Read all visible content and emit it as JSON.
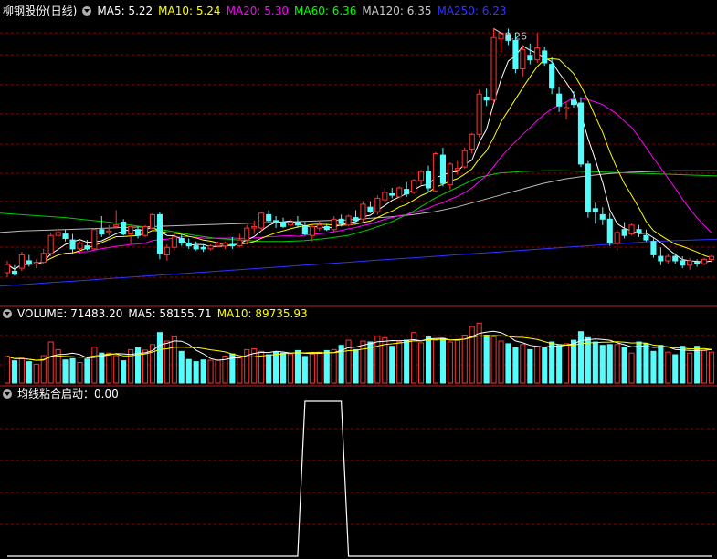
{
  "price_panel": {
    "title": "柳钢股份(日线)",
    "ma_legend": [
      {
        "label": "MA5: 5.22",
        "color": "#ffffff"
      },
      {
        "label": "MA10: 5.24",
        "color": "#ffff00"
      },
      {
        "label": "MA20: 5.30",
        "color": "#ff00ff"
      },
      {
        "label": "MA60: 6.36",
        "color": "#00ff00"
      },
      {
        "label": "MA120: 6.35",
        "color": "#cccccc"
      },
      {
        "label": "MA250: 6.23",
        "color": "#3333ff"
      }
    ],
    "peak_label": "8.26"
  },
  "volume_panel": {
    "legend": [
      {
        "label": "VOLUME: 71483.20",
        "color": "#ffffff"
      },
      {
        "label": "MA5: 58155.71",
        "color": "#ffffff"
      },
      {
        "label": "MA10: 89735.93",
        "color": "#ffff00"
      }
    ]
  },
  "indicator_panel": {
    "legend": [
      {
        "label": "均线粘合启动：0.00",
        "color": "#ffffff"
      }
    ]
  },
  "colors": {
    "up": "#ff3333",
    "down": "#54fcfc",
    "grid": "#8b0000",
    "frame": "#b22222"
  },
  "chart_data": {
    "type": "candlestick",
    "candles": [
      {
        "o": 4.98,
        "h": 5.14,
        "l": 4.92,
        "c": 5.09
      },
      {
        "o": 5.0,
        "h": 5.08,
        "l": 4.94,
        "c": 4.96
      },
      {
        "o": 5.04,
        "h": 5.26,
        "l": 5.0,
        "c": 5.22
      },
      {
        "o": 5.14,
        "h": 5.22,
        "l": 5.06,
        "c": 5.1
      },
      {
        "o": 5.1,
        "h": 5.16,
        "l": 5.04,
        "c": 5.12
      },
      {
        "o": 5.12,
        "h": 5.3,
        "l": 5.1,
        "c": 5.24
      },
      {
        "o": 5.24,
        "h": 5.52,
        "l": 5.2,
        "c": 5.48
      },
      {
        "o": 5.48,
        "h": 5.6,
        "l": 5.42,
        "c": 5.52
      },
      {
        "o": 5.5,
        "h": 5.56,
        "l": 5.4,
        "c": 5.44
      },
      {
        "o": 5.42,
        "h": 5.5,
        "l": 5.24,
        "c": 5.3
      },
      {
        "o": 5.3,
        "h": 5.4,
        "l": 5.24,
        "c": 5.38
      },
      {
        "o": 5.34,
        "h": 5.42,
        "l": 5.28,
        "c": 5.3
      },
      {
        "o": 5.3,
        "h": 5.58,
        "l": 5.28,
        "c": 5.56
      },
      {
        "o": 5.56,
        "h": 5.74,
        "l": 5.46,
        "c": 5.5
      },
      {
        "o": 5.52,
        "h": 5.62,
        "l": 5.48,
        "c": 5.54
      },
      {
        "o": 5.6,
        "h": 5.82,
        "l": 5.58,
        "c": 5.62
      },
      {
        "o": 5.66,
        "h": 5.7,
        "l": 5.48,
        "c": 5.5
      },
      {
        "o": 5.5,
        "h": 5.62,
        "l": 5.36,
        "c": 5.6
      },
      {
        "o": 5.56,
        "h": 5.6,
        "l": 5.44,
        "c": 5.48
      },
      {
        "o": 5.48,
        "h": 5.62,
        "l": 5.46,
        "c": 5.6
      },
      {
        "o": 5.58,
        "h": 5.78,
        "l": 5.56,
        "c": 5.76
      },
      {
        "o": 5.76,
        "h": 5.8,
        "l": 5.16,
        "c": 5.24
      },
      {
        "o": 5.22,
        "h": 5.36,
        "l": 5.14,
        "c": 5.32
      },
      {
        "o": 5.32,
        "h": 5.5,
        "l": 5.28,
        "c": 5.46
      },
      {
        "o": 5.44,
        "h": 5.5,
        "l": 5.34,
        "c": 5.38
      },
      {
        "o": 5.38,
        "h": 5.44,
        "l": 5.3,
        "c": 5.34
      },
      {
        "o": 5.34,
        "h": 5.4,
        "l": 5.28,
        "c": 5.3
      },
      {
        "o": 5.32,
        "h": 5.36,
        "l": 5.26,
        "c": 5.3
      },
      {
        "o": 5.3,
        "h": 5.36,
        "l": 5.28,
        "c": 5.34
      },
      {
        "o": 5.34,
        "h": 5.4,
        "l": 5.32,
        "c": 5.38
      },
      {
        "o": 5.34,
        "h": 5.4,
        "l": 5.3,
        "c": 5.38
      },
      {
        "o": 5.36,
        "h": 5.46,
        "l": 5.3,
        "c": 5.34
      },
      {
        "o": 5.34,
        "h": 5.5,
        "l": 5.32,
        "c": 5.42
      },
      {
        "o": 5.42,
        "h": 5.62,
        "l": 5.36,
        "c": 5.58
      },
      {
        "o": 5.58,
        "h": 5.68,
        "l": 5.5,
        "c": 5.6
      },
      {
        "o": 5.58,
        "h": 5.8,
        "l": 5.54,
        "c": 5.78
      },
      {
        "o": 5.76,
        "h": 5.82,
        "l": 5.66,
        "c": 5.68
      },
      {
        "o": 5.68,
        "h": 5.74,
        "l": 5.58,
        "c": 5.66
      },
      {
        "o": 5.66,
        "h": 5.72,
        "l": 5.58,
        "c": 5.6
      },
      {
        "o": 5.62,
        "h": 5.7,
        "l": 5.6,
        "c": 5.66
      },
      {
        "o": 5.66,
        "h": 5.74,
        "l": 5.58,
        "c": 5.62
      },
      {
        "o": 5.6,
        "h": 5.66,
        "l": 5.48,
        "c": 5.5
      },
      {
        "o": 5.48,
        "h": 5.62,
        "l": 5.4,
        "c": 5.6
      },
      {
        "o": 5.58,
        "h": 5.68,
        "l": 5.54,
        "c": 5.62
      },
      {
        "o": 5.6,
        "h": 5.64,
        "l": 5.54,
        "c": 5.56
      },
      {
        "o": 5.56,
        "h": 5.74,
        "l": 5.52,
        "c": 5.7
      },
      {
        "o": 5.7,
        "h": 5.76,
        "l": 5.6,
        "c": 5.64
      },
      {
        "o": 5.62,
        "h": 5.76,
        "l": 5.6,
        "c": 5.74
      },
      {
        "o": 5.72,
        "h": 5.82,
        "l": 5.66,
        "c": 5.68
      },
      {
        "o": 5.7,
        "h": 5.94,
        "l": 5.66,
        "c": 5.9
      },
      {
        "o": 5.86,
        "h": 5.94,
        "l": 5.78,
        "c": 5.8
      },
      {
        "o": 5.8,
        "h": 6.02,
        "l": 5.76,
        "c": 5.98
      },
      {
        "o": 5.96,
        "h": 6.12,
        "l": 5.92,
        "c": 6.06
      },
      {
        "o": 6.04,
        "h": 6.12,
        "l": 5.98,
        "c": 6.02
      },
      {
        "o": 6.0,
        "h": 6.14,
        "l": 5.98,
        "c": 6.12
      },
      {
        "o": 6.1,
        "h": 6.2,
        "l": 6.0,
        "c": 6.04
      },
      {
        "o": 6.06,
        "h": 6.24,
        "l": 6.04,
        "c": 6.22
      },
      {
        "o": 6.22,
        "h": 6.36,
        "l": 6.16,
        "c": 6.34
      },
      {
        "o": 6.34,
        "h": 6.42,
        "l": 6.06,
        "c": 6.12
      },
      {
        "o": 6.08,
        "h": 6.6,
        "l": 6.06,
        "c": 6.58
      },
      {
        "o": 6.56,
        "h": 6.66,
        "l": 6.14,
        "c": 6.18
      },
      {
        "o": 6.16,
        "h": 6.46,
        "l": 6.1,
        "c": 6.44
      },
      {
        "o": 6.36,
        "h": 6.48,
        "l": 6.3,
        "c": 6.38
      },
      {
        "o": 6.4,
        "h": 6.66,
        "l": 6.38,
        "c": 6.62
      },
      {
        "o": 6.64,
        "h": 6.86,
        "l": 6.58,
        "c": 6.84
      },
      {
        "o": 6.84,
        "h": 7.44,
        "l": 6.8,
        "c": 7.38
      },
      {
        "o": 7.34,
        "h": 7.46,
        "l": 7.22,
        "c": 7.3
      },
      {
        "o": 7.3,
        "h": 8.26,
        "l": 7.26,
        "c": 8.14
      },
      {
        "o": 8.12,
        "h": 8.22,
        "l": 7.94,
        "c": 8.2
      },
      {
        "o": 8.18,
        "h": 8.26,
        "l": 8.04,
        "c": 8.1
      },
      {
        "o": 8.1,
        "h": 8.2,
        "l": 7.66,
        "c": 7.72
      },
      {
        "o": 7.72,
        "h": 8.04,
        "l": 7.62,
        "c": 7.98
      },
      {
        "o": 7.9,
        "h": 8.06,
        "l": 7.78,
        "c": 7.84
      },
      {
        "o": 7.84,
        "h": 8.2,
        "l": 7.8,
        "c": 8.0
      },
      {
        "o": 7.96,
        "h": 8.02,
        "l": 7.76,
        "c": 7.8
      },
      {
        "o": 7.78,
        "h": 7.88,
        "l": 7.38,
        "c": 7.46
      },
      {
        "o": 7.38,
        "h": 7.48,
        "l": 7.14,
        "c": 7.22
      },
      {
        "o": 7.18,
        "h": 7.28,
        "l": 7.04,
        "c": 7.2
      },
      {
        "o": 7.3,
        "h": 7.42,
        "l": 7.2,
        "c": 7.24
      },
      {
        "o": 7.26,
        "h": 7.34,
        "l": 6.4,
        "c": 6.44
      },
      {
        "o": 6.44,
        "h": 6.48,
        "l": 5.72,
        "c": 5.8
      },
      {
        "o": 5.84,
        "h": 5.92,
        "l": 5.64,
        "c": 5.8
      },
      {
        "o": 5.76,
        "h": 5.86,
        "l": 5.62,
        "c": 5.7
      },
      {
        "o": 5.7,
        "h": 5.78,
        "l": 5.34,
        "c": 5.38
      },
      {
        "o": 5.38,
        "h": 5.56,
        "l": 5.28,
        "c": 5.52
      },
      {
        "o": 5.56,
        "h": 5.66,
        "l": 5.44,
        "c": 5.48
      },
      {
        "o": 5.5,
        "h": 5.64,
        "l": 5.48,
        "c": 5.62
      },
      {
        "o": 5.56,
        "h": 5.62,
        "l": 5.46,
        "c": 5.52
      },
      {
        "o": 5.48,
        "h": 5.56,
        "l": 5.4,
        "c": 5.42
      },
      {
        "o": 5.4,
        "h": 5.44,
        "l": 5.18,
        "c": 5.22
      },
      {
        "o": 5.2,
        "h": 5.32,
        "l": 5.08,
        "c": 5.14
      },
      {
        "o": 5.14,
        "h": 5.24,
        "l": 5.1,
        "c": 5.2
      },
      {
        "o": 5.2,
        "h": 5.24,
        "l": 5.1,
        "c": 5.14
      },
      {
        "o": 5.14,
        "h": 5.2,
        "l": 5.04,
        "c": 5.08
      },
      {
        "o": 5.08,
        "h": 5.18,
        "l": 5.02,
        "c": 5.14
      },
      {
        "o": 5.12,
        "h": 5.16,
        "l": 5.06,
        "c": 5.1
      },
      {
        "o": 5.1,
        "h": 5.18,
        "l": 5.08,
        "c": 5.16
      },
      {
        "o": 5.16,
        "h": 5.22,
        "l": 5.12,
        "c": 5.2
      }
    ],
    "ma_long": {
      "ma60": [
        5.78,
        5.76,
        5.74,
        5.72,
        5.69,
        5.66,
        5.62,
        5.58,
        5.53,
        5.48,
        5.44,
        5.42,
        5.4,
        5.4,
        5.41,
        5.44,
        5.48,
        5.56,
        5.66,
        5.8,
        5.98,
        6.12,
        6.26,
        6.32,
        6.34,
        6.35,
        6.35,
        6.34,
        6.33,
        6.32,
        6.31,
        6.3,
        6.29,
        6.28
      ],
      "ma120": [
        5.52,
        5.54,
        5.55,
        5.56,
        5.57,
        5.58,
        5.59,
        5.6,
        5.61,
        5.62,
        5.63,
        5.64,
        5.65,
        5.66,
        5.67,
        5.68,
        5.69,
        5.71,
        5.73,
        5.76,
        5.8,
        5.86,
        5.94,
        6.02,
        6.1,
        6.18,
        6.24,
        6.28,
        6.31,
        6.33,
        6.34,
        6.35,
        6.35,
        6.35
      ],
      "ma250": [
        4.8,
        4.82,
        4.84,
        4.86,
        4.88,
        4.9,
        4.92,
        4.94,
        4.96,
        4.98,
        5.0,
        5.02,
        5.04,
        5.06,
        5.08,
        5.1,
        5.12,
        5.14,
        5.16,
        5.18,
        5.2,
        5.22,
        5.24,
        5.26,
        5.28,
        5.3,
        5.32,
        5.34,
        5.36,
        5.38,
        5.4,
        5.41,
        5.42,
        5.43
      ]
    },
    "volume": [
      62000,
      52000,
      58000,
      50000,
      44000,
      64000,
      96000,
      78000,
      54000,
      57000,
      48000,
      56000,
      84000,
      70000,
      70000,
      64000,
      52000,
      78000,
      82000,
      77000,
      90000,
      118000,
      98000,
      108000,
      74000,
      55000,
      50000,
      54000,
      53000,
      54000,
      63000,
      68000,
      58000,
      78000,
      80000,
      74000,
      66000,
      72000,
      70000,
      68000,
      76000,
      62000,
      68000,
      72000,
      76000,
      78000,
      88000,
      100000,
      78000,
      98000,
      96000,
      110000,
      106000,
      86000,
      96000,
      100000,
      118000,
      94000,
      108000,
      100000,
      104000,
      96000,
      100000,
      112000,
      132000,
      140000,
      112000,
      108000,
      98000,
      92000,
      82000,
      90000,
      78000,
      86000,
      82000,
      96000,
      88000,
      92000,
      100000,
      120000,
      106000,
      96000,
      88000,
      90000,
      90000,
      84000,
      70000,
      96000,
      92000,
      74000,
      88000,
      72000,
      66000,
      86000,
      70000,
      86000,
      76000,
      72000
    ],
    "indicator": [
      0,
      0,
      0,
      0,
      0,
      0,
      0,
      0,
      0,
      0,
      0,
      0,
      0,
      0,
      0,
      0,
      0,
      0,
      0,
      0,
      0,
      0,
      0,
      0,
      0,
      0,
      0,
      0,
      0,
      0,
      0,
      0,
      0,
      0,
      0,
      0,
      0,
      0,
      0,
      0,
      0,
      1,
      1,
      1,
      1,
      1,
      1,
      0,
      0,
      0,
      0,
      0,
      0,
      0,
      0,
      0,
      0,
      0,
      0,
      0,
      0,
      0,
      0,
      0,
      0,
      0,
      0,
      0,
      0,
      0,
      0,
      0,
      0,
      0,
      0,
      0,
      0,
      0,
      0,
      0,
      0,
      0,
      0,
      0,
      0,
      0,
      0,
      0,
      0,
      0,
      0,
      0,
      0,
      0,
      0,
      0,
      0,
      0
    ],
    "price_range": [
      4.6,
      8.4
    ]
  }
}
